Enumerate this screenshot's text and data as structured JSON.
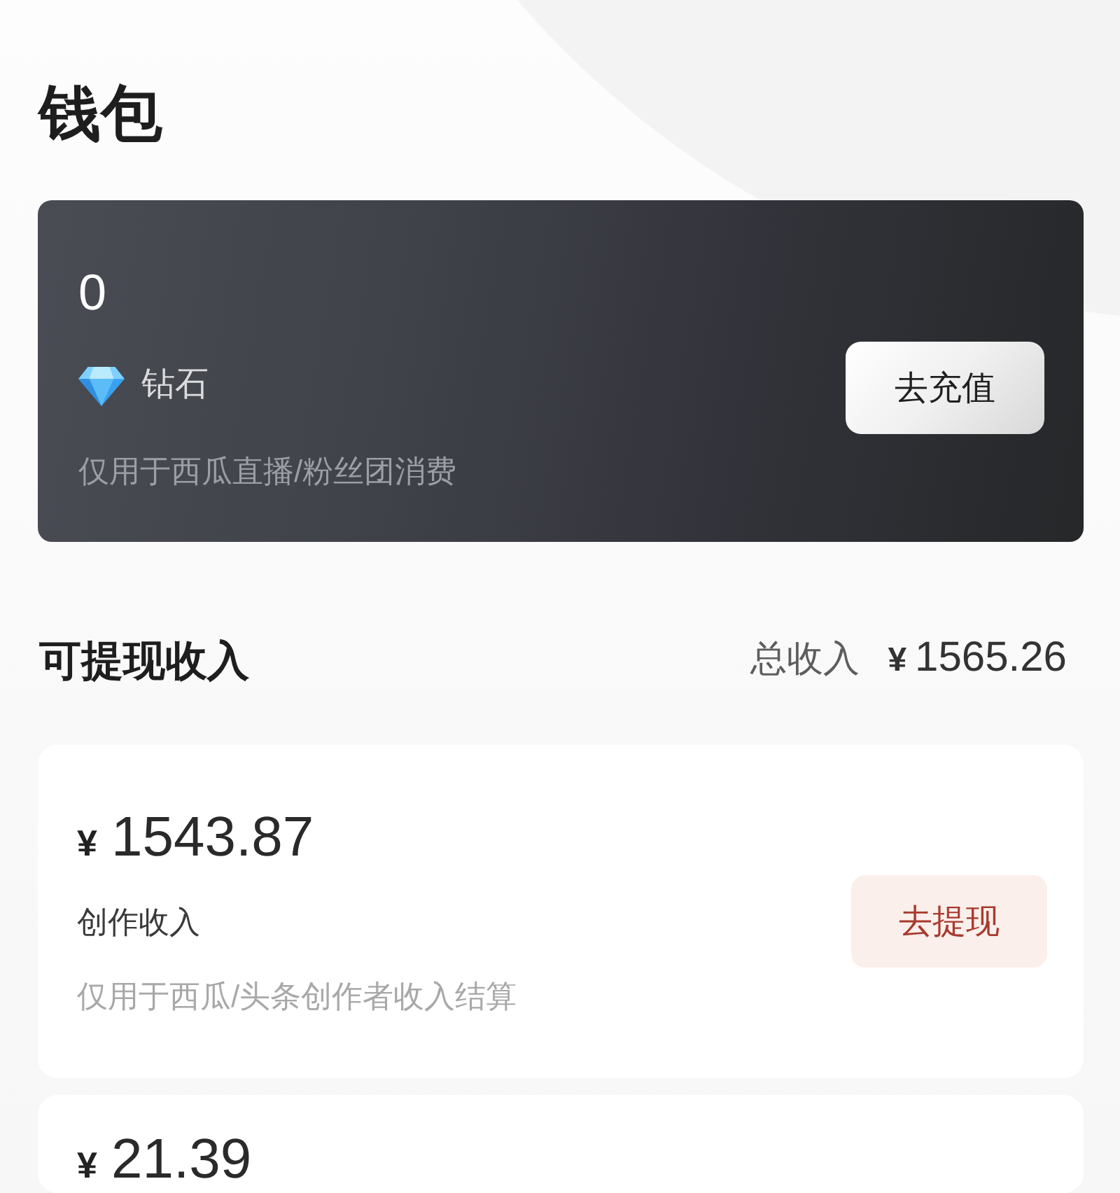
{
  "page": {
    "title": "钱包"
  },
  "diamond_card": {
    "balance": "0",
    "unit": "钻石",
    "note": "仅用于西瓜直播/粉丝团消费",
    "button": "去充值"
  },
  "income": {
    "title": "可提现收入",
    "total_label": "总收入",
    "total_currency": "¥",
    "total_amount": "1565.26"
  },
  "accounts": [
    {
      "currency": "¥",
      "amount": "1543.87",
      "name": "创作收入",
      "note": "仅用于西瓜/头条创作者收入结算",
      "button": "去提现"
    },
    {
      "currency": "¥",
      "amount": "21.39"
    }
  ]
}
